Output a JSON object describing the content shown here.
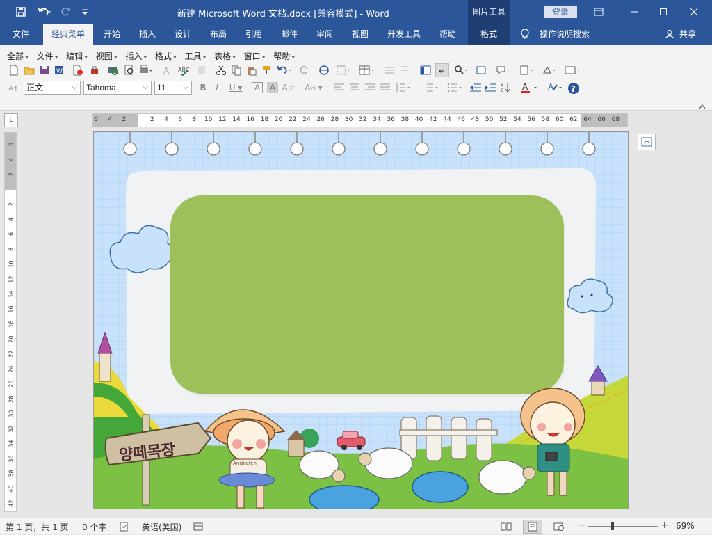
{
  "titlebar": {
    "title": "新建 Microsoft Word 文档.docx [兼容模式]  -  Word",
    "context_group": "图片工具",
    "login": "登录",
    "icons": [
      "save-icon",
      "undo-icon",
      "redo-icon",
      "customize-icon",
      "ribbon-display-icon",
      "minimize-icon",
      "maximize-icon",
      "close-icon"
    ]
  },
  "tabs": {
    "file": "文件",
    "classic": "经典菜单",
    "home": "开始",
    "insert": "插入",
    "design": "设计",
    "layout": "布局",
    "references": "引用",
    "mailings": "邮件",
    "review": "审阅",
    "view": "视图",
    "developer": "开发工具",
    "help": "帮助",
    "format": "格式",
    "tellme": "操作说明搜索",
    "share": "共享"
  },
  "menus": [
    "全部",
    "文件",
    "编辑",
    "视图",
    "插入",
    "格式",
    "工具",
    "表格",
    "窗口",
    "帮助"
  ],
  "toolbar": {
    "style": "正文",
    "font": "Tahoma",
    "size": "11"
  },
  "ruler": {
    "h_numbers": [
      "6",
      "4",
      "2",
      "2",
      "4",
      "6",
      "8",
      "10",
      "12",
      "14",
      "16",
      "18",
      "20",
      "22",
      "24",
      "26",
      "28",
      "30",
      "32",
      "34",
      "36",
      "38",
      "40",
      "42",
      "44",
      "46",
      "48",
      "50",
      "52",
      "54",
      "56",
      "58",
      "60",
      "62",
      "64",
      "66",
      "68"
    ],
    "v_numbers": [
      "6",
      "4",
      "2",
      "2",
      "4",
      "6",
      "8",
      "10",
      "12",
      "14",
      "16",
      "18",
      "20",
      "22",
      "24",
      "26",
      "28",
      "30",
      "32",
      "34",
      "36",
      "38",
      "40",
      "42"
    ]
  },
  "document": {
    "sign_text": "양떼목장",
    "badge_text": "Anisketch"
  },
  "status": {
    "page": "第 1 页，共 1 页",
    "words": "0 个字",
    "language": "英语(美国)",
    "zoom": "69%",
    "zoom_level": 0.69,
    "colors": {
      "titlebar": "#2b579a",
      "green_panel": "#9dc05a",
      "grid_bg": "#c8e2fb"
    }
  }
}
